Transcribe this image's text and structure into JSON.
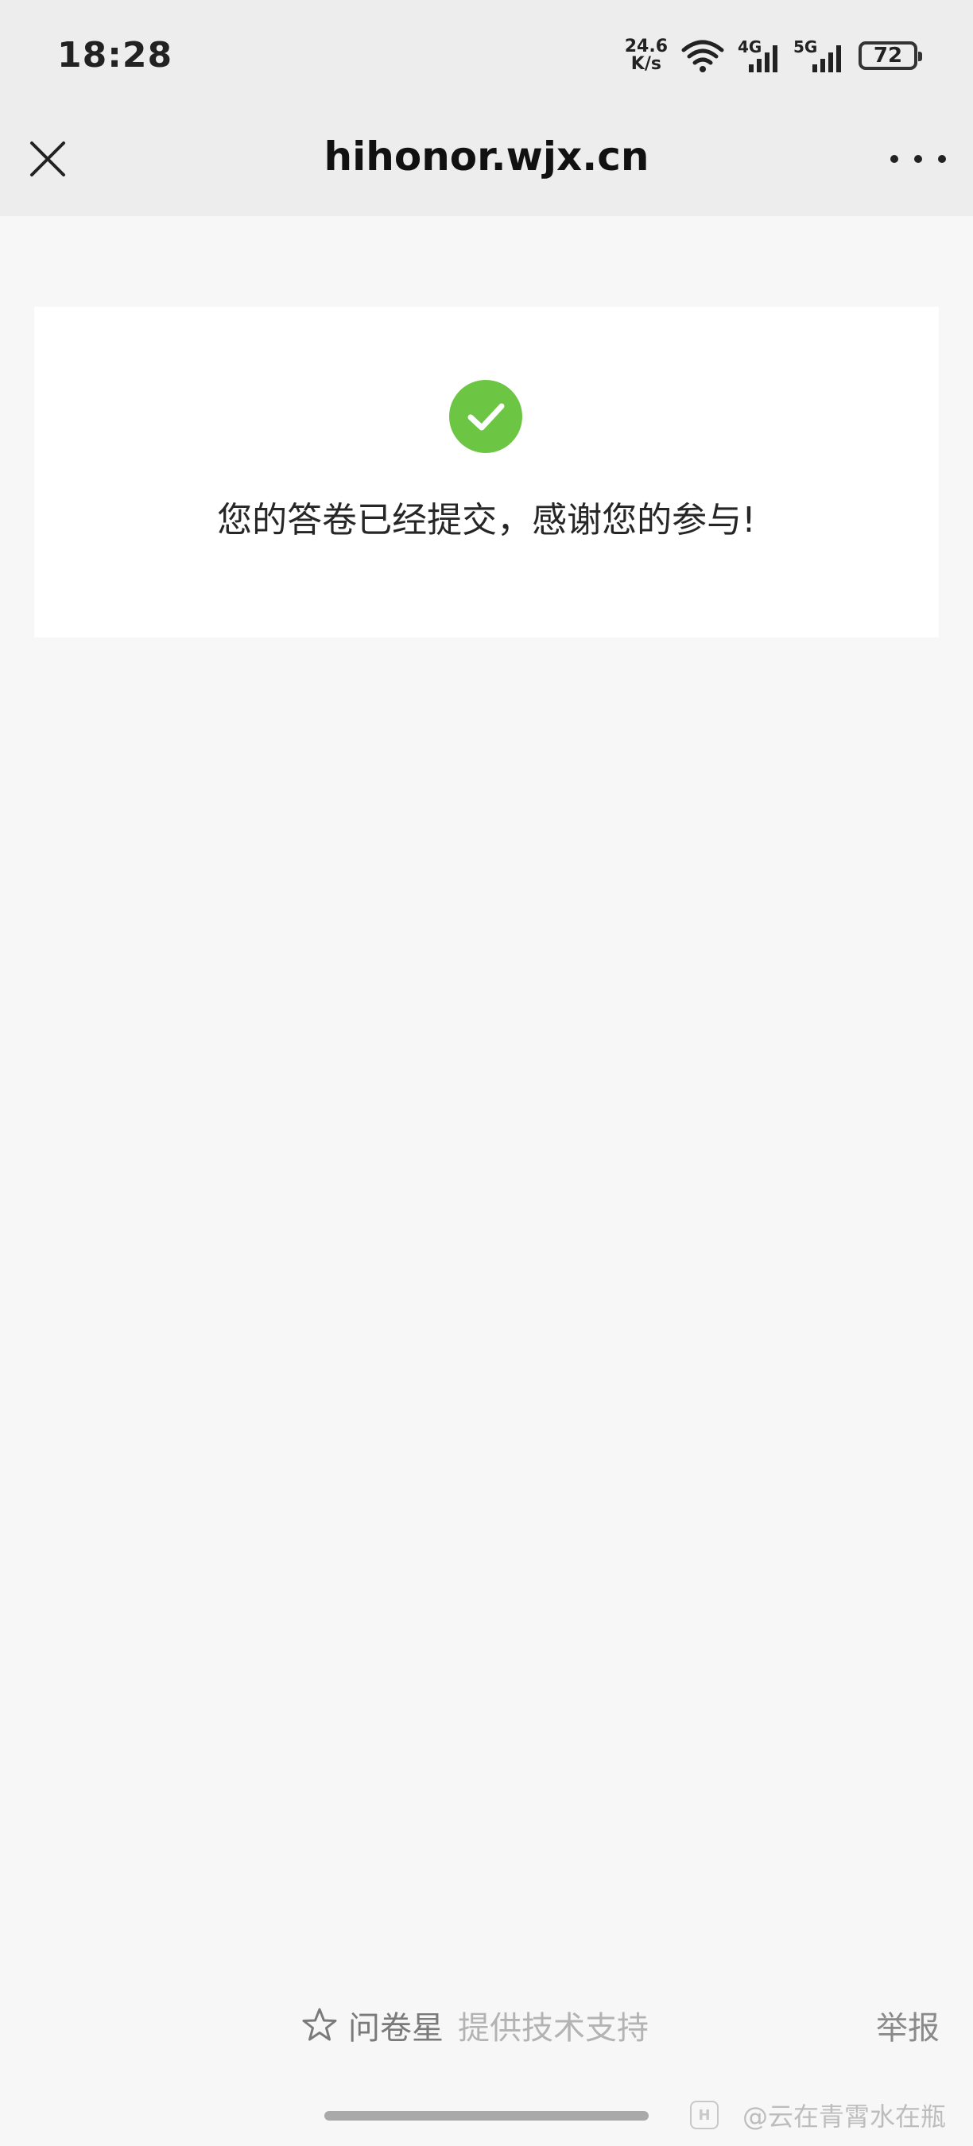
{
  "status_bar": {
    "time": "18:28",
    "net_speed_value": "24.6",
    "net_speed_unit": "K/s",
    "network_4g": "4G",
    "network_5g": "5G",
    "battery": "72",
    "icons": [
      "wifi-icon",
      "signal-4g-icon",
      "signal-5g-icon",
      "battery-icon"
    ]
  },
  "nav": {
    "title": "hihonor.wjx.cn",
    "close_icon": "close-icon",
    "more_icon": "more-icon"
  },
  "card": {
    "icon": "check-circle-icon",
    "message": "您的答卷已经提交，感谢您的参与!",
    "accent_color": "#6cc644"
  },
  "footer": {
    "brand_icon": "star-icon",
    "brand_name": "问卷星",
    "support_text": "提供技术支持",
    "report_label": "举报"
  },
  "watermark": {
    "text": "@云在青霄水在瓶"
  }
}
